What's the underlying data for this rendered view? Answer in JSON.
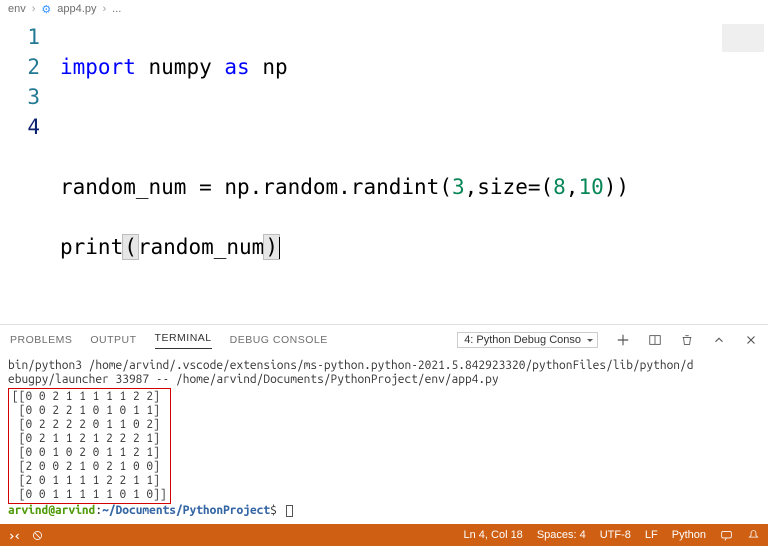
{
  "breadcrumb": {
    "folder": "env",
    "file": "app4.py",
    "symbol": "..."
  },
  "editor": {
    "line_numbers": [
      "1",
      "2",
      "3",
      "4"
    ],
    "current_line_index": 3,
    "code": {
      "l1": {
        "import": "import",
        "mod": "numpy",
        "as": "as",
        "alias": "np"
      },
      "l2": "",
      "l3": {
        "var": "random_num",
        "eq": " = ",
        "expr1": "np.random.randint",
        "lp": "(",
        "n1": "3",
        "c1": ",size=",
        "lp2": "(",
        "n2": "8",
        "c2": ",",
        "n3": "10",
        "rp2": ")",
        "rp": ")"
      },
      "l4": {
        "fn": "print",
        "lp": "(",
        "arg": "random_num",
        "rp": ")"
      }
    }
  },
  "panel": {
    "tabs": {
      "problems": "PROBLEMS",
      "output": "OUTPUT",
      "terminal": "TERMINAL",
      "debug": "DEBUG CONSOLE"
    },
    "dropdown": "4: Python Debug Conso",
    "terminal": {
      "pre1": "bin/python3 /home/arvind/.vscode/extensions/ms-python.python-2021.5.842923320/pythonFiles/lib/python/d",
      "pre2": "ebugpy/launcher 33987 -- /home/arvind/Documents/PythonProject/env/app4.py",
      "rows": [
        "[[0 0 2 1 1 1 1 1 2 2]",
        " [0 0 2 2 1 0 1 0 1 1]",
        " [0 2 2 2 2 0 1 1 0 2]",
        " [0 2 1 1 2 1 2 2 2 1]",
        " [0 0 1 0 2 0 1 1 2 1]",
        " [2 0 0 2 1 0 2 1 0 0]",
        " [2 0 1 1 1 1 2 2 1 1]",
        " [0 0 1 1 1 1 1 0 1 0]]"
      ],
      "prompt_user": "arvind@arvind",
      "prompt_sep": ":",
      "prompt_path": "~/Documents/PythonProject",
      "prompt_end": "$ "
    }
  },
  "statusbar": {
    "line_col": "Ln 4, Col 18",
    "spaces": "Spaces: 4",
    "encoding": "UTF-8",
    "eol": "LF",
    "lang": "Python"
  }
}
